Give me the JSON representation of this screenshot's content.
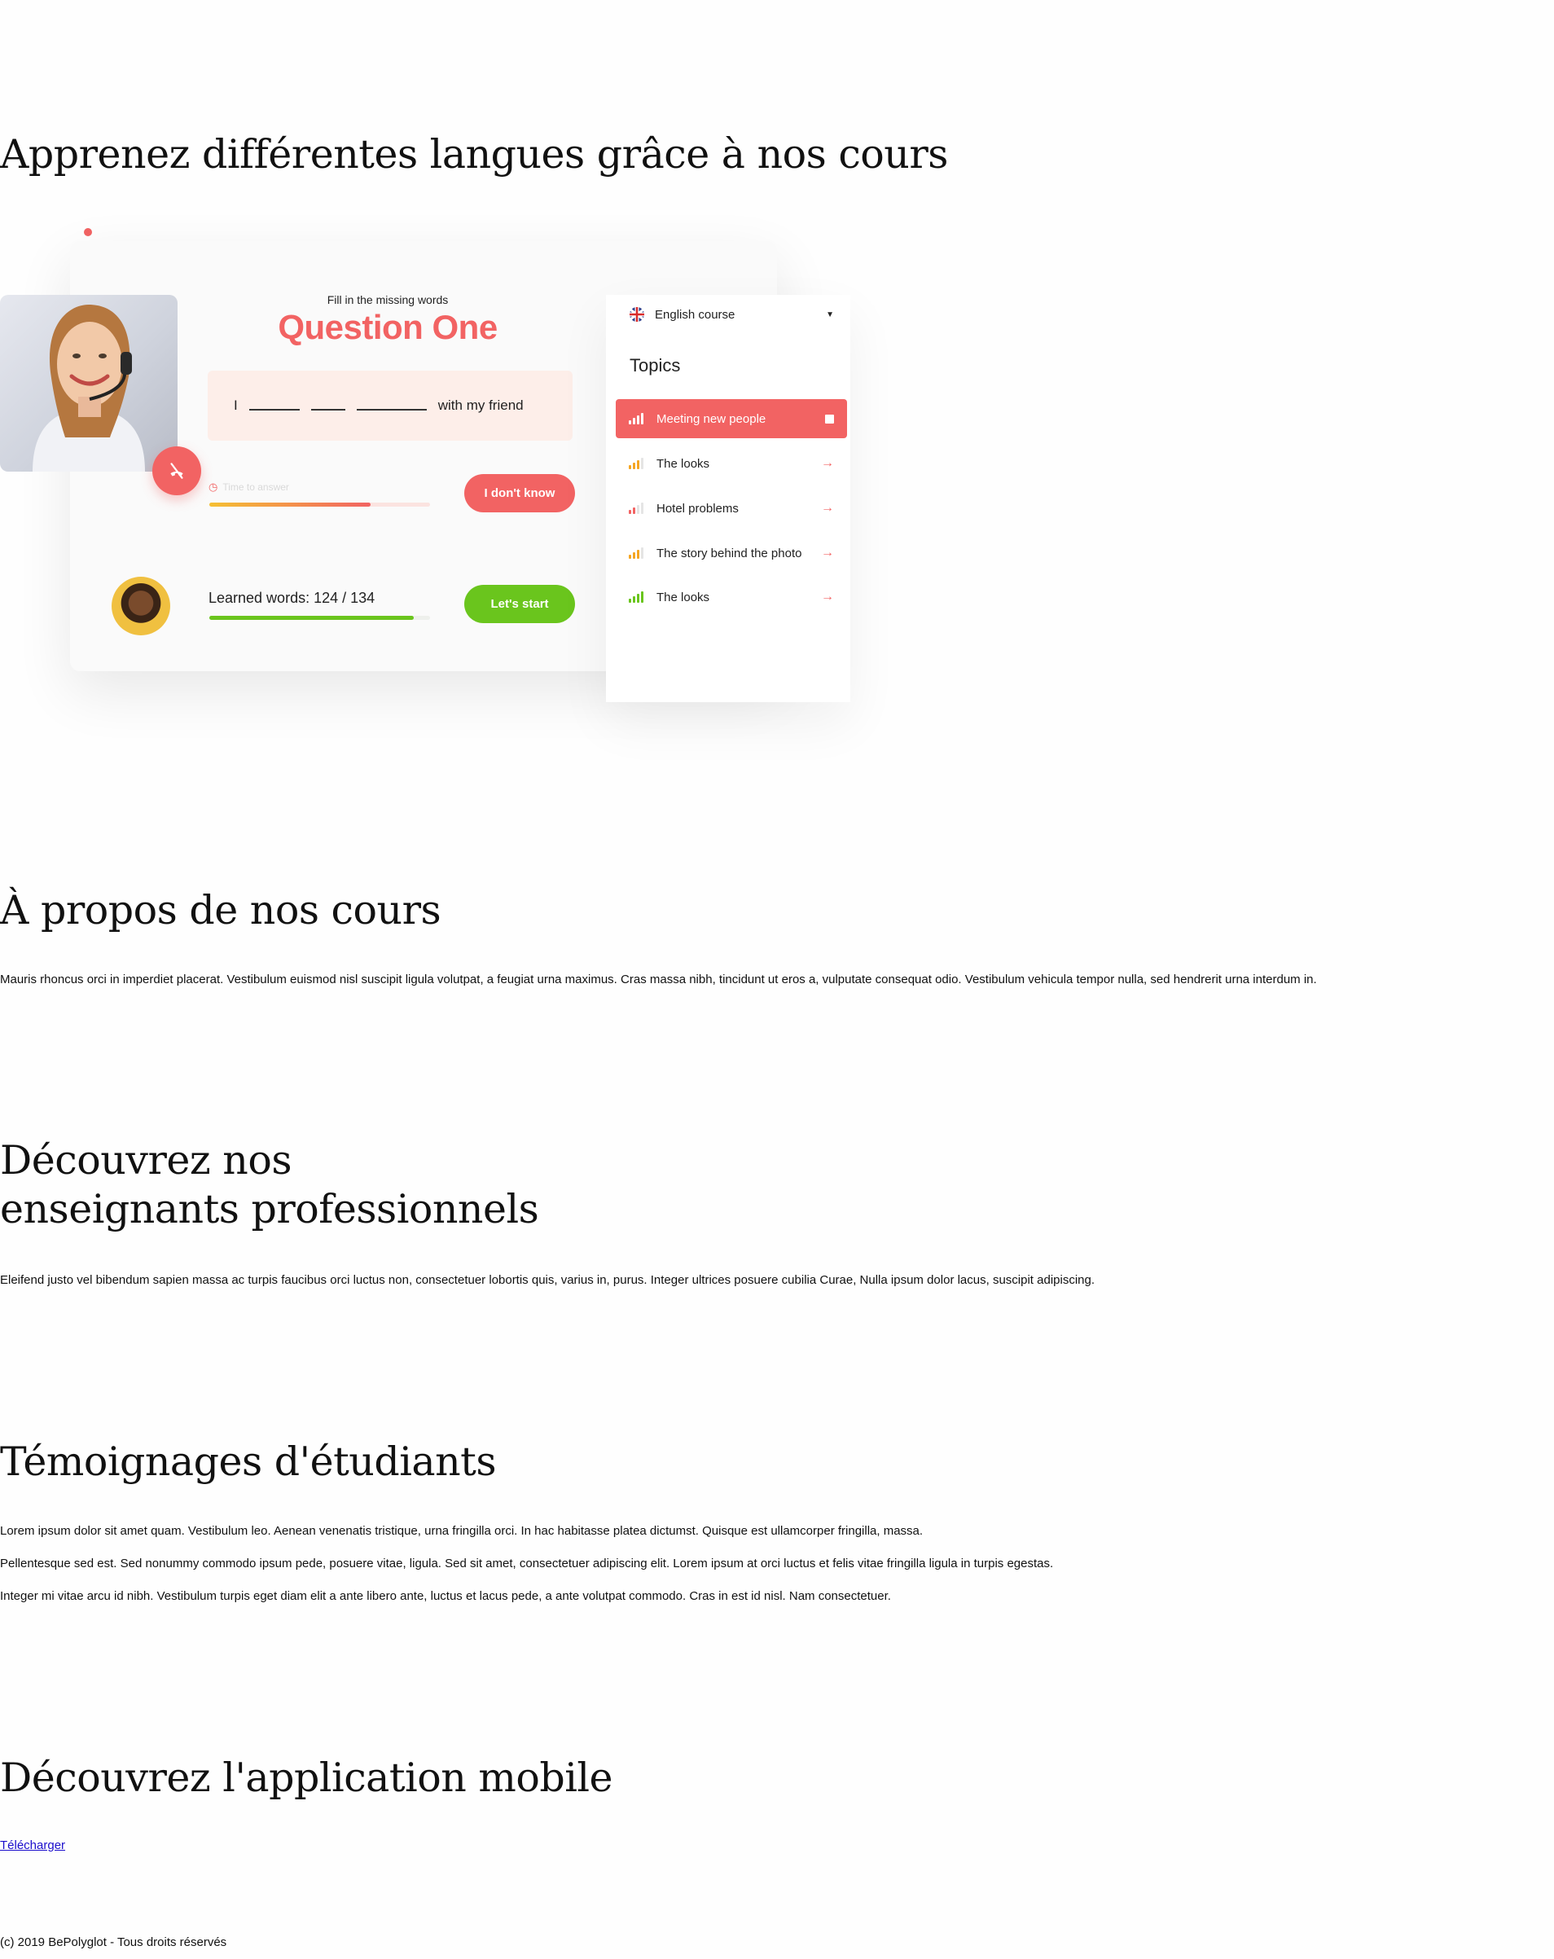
{
  "hero": {
    "title": "Apprenez différentes langues grâce à nos cours",
    "quiz": {
      "subtitle": "Fill in the missing words",
      "title": "Question One",
      "sentence_start": "I",
      "sentence_end": "with my friend",
      "timer_label": "Time to answer",
      "timer_progress": 0.73,
      "dont_know_label": "I don't know",
      "learned_label": "Learned words: 124 / 134",
      "learned_progress": 0.925,
      "start_label": "Let's start"
    },
    "course_select": "English course",
    "topics_title": "Topics",
    "topics": [
      {
        "label": "Meeting new people",
        "active": true,
        "level": 4
      },
      {
        "label": "The looks",
        "active": false,
        "level": 3
      },
      {
        "label": "Hotel problems",
        "active": false,
        "level": 2
      },
      {
        "label": "The story behind the photo",
        "active": false,
        "level": 3
      },
      {
        "label": "The looks",
        "active": false,
        "level": 4
      }
    ],
    "colors": {
      "accent": "#f26363",
      "green": "#6ac51d",
      "orange": "#f5a623"
    }
  },
  "about": {
    "title": "À propos de nos cours",
    "text": "Mauris rhoncus orci in imperdiet placerat. Vestibulum euismod nisl suscipit ligula volutpat, a feugiat urna maximus. Cras massa nibh, tincidunt ut eros a, vulputate consequat odio. Vestibulum vehicula tempor nulla, sed hendrerit urna interdum in."
  },
  "teachers": {
    "title_line1": "Découvrez nos",
    "title_line2": "enseignants professionnels",
    "text": "Eleifend justo vel bibendum sapien massa ac turpis faucibus orci luctus non, consectetuer lobortis quis, varius in, purus. Integer ultrices posuere cubilia Curae, Nulla ipsum dolor lacus, suscipit adipiscing."
  },
  "testimonials": {
    "title": "Témoignages d'étudiants",
    "items": [
      "Lorem ipsum dolor sit amet quam. Vestibulum leo. Aenean venenatis tristique, urna fringilla orci. In hac habitasse platea dictumst. Quisque est ullamcorper fringilla, massa.",
      "Pellentesque sed est. Sed nonummy commodo ipsum pede, posuere vitae, ligula. Sed sit amet, consectetuer adipiscing elit. Lorem ipsum at orci luctus et felis vitae fringilla ligula in turpis egestas.",
      "Integer mi vitae arcu id nibh. Vestibulum turpis eget diam elit a ante libero ante, luctus et lacus pede, a ante volutpat commodo. Cras in est id nisl. Nam consectetuer."
    ]
  },
  "app": {
    "title": "Découvrez l'application mobile",
    "link": "Télécharger"
  },
  "footer": {
    "text": "(c) 2019 BePolyglot - Tous droits réservés"
  }
}
